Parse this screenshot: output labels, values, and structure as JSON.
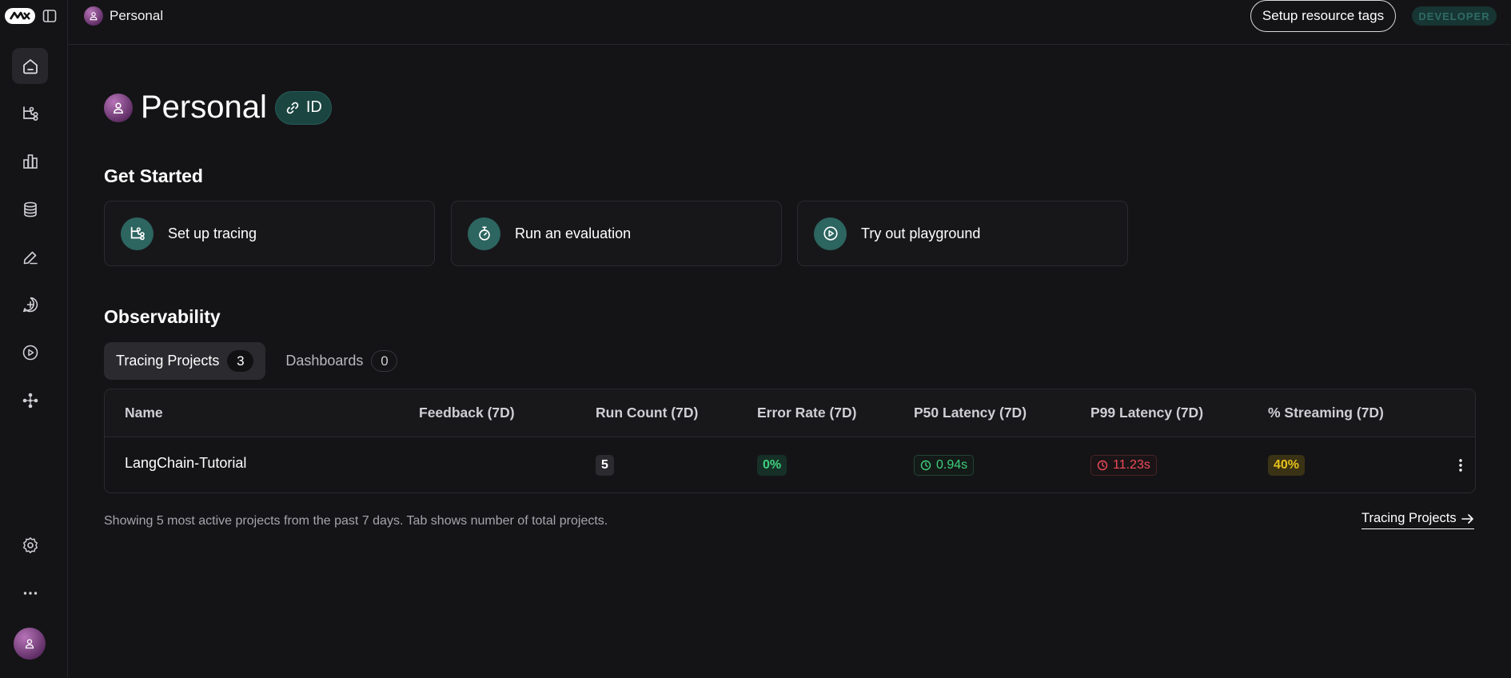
{
  "topbar": {
    "breadcrumb_label": "Personal",
    "setup_tags_label": "Setup resource tags",
    "plan_badge": "DEVELOPER"
  },
  "sidebar": {
    "items": [
      {
        "icon": "home-icon",
        "active": true
      },
      {
        "icon": "tracing-icon",
        "active": false
      },
      {
        "icon": "monitoring-icon",
        "active": false
      },
      {
        "icon": "datasets-icon",
        "active": false
      },
      {
        "icon": "annotation-icon",
        "active": false
      },
      {
        "icon": "prompts-icon",
        "active": false
      },
      {
        "icon": "playground-icon",
        "active": false
      },
      {
        "icon": "deployments-icon",
        "active": false
      }
    ],
    "bottom": [
      "settings-icon",
      "more-icon",
      "user-avatar"
    ]
  },
  "main": {
    "title": "Personal",
    "id_label": "ID",
    "get_started": {
      "heading": "Get Started",
      "cards": [
        {
          "label": "Set up tracing",
          "icon": "tracing-icon"
        },
        {
          "label": "Run an evaluation",
          "icon": "stopwatch-icon"
        },
        {
          "label": "Try out playground",
          "icon": "play-circle-icon"
        }
      ]
    },
    "observability": {
      "heading": "Observability",
      "tabs": [
        {
          "label": "Tracing Projects",
          "count": "3",
          "active": true
        },
        {
          "label": "Dashboards",
          "count": "0",
          "active": false
        }
      ],
      "columns": [
        "Name",
        "Feedback (7D)",
        "Run Count (7D)",
        "Error Rate (7D)",
        "P50 Latency (7D)",
        "P99 Latency (7D)",
        "% Streaming (7D)"
      ],
      "rows": [
        {
          "name": "LangChain-Tutorial",
          "feedback": "",
          "run_count": "5",
          "error_rate": "0%",
          "p50_latency": "0.94s",
          "p99_latency": "11.23s",
          "streaming": "40%"
        }
      ],
      "footnote": "Showing 5 most active projects from the past 7 days. Tab shows number of total projects.",
      "footer_link": "Tracing Projects"
    }
  },
  "colors": {
    "background": "#141416",
    "accent_teal": "#2d6560",
    "success": "#3ecf7d",
    "danger": "#ef4b5a",
    "warning": "#e8c21c"
  }
}
